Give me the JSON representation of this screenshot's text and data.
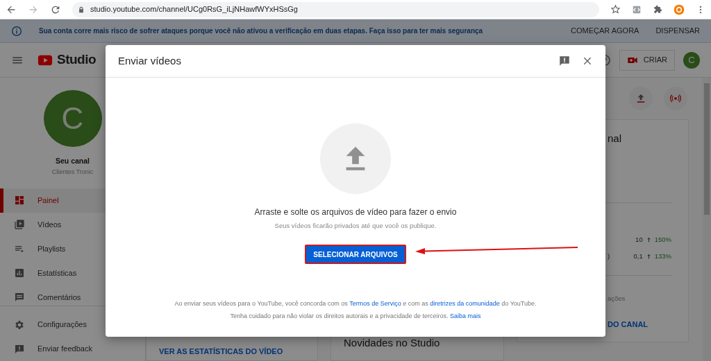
{
  "browser": {
    "url": "studio.youtube.com/channel/UCg0RsG_iLjNHawfWYxHSsGg"
  },
  "banner": {
    "message": "Sua conta corre mais risco de sofrer ataques porque você não ativou a verificação em duas etapas. Faça isso para ter mais segurança",
    "actions": [
      "COMEÇAR AGORA",
      "DISPENSAR"
    ]
  },
  "header": {
    "logo": "Studio",
    "create_button": "CRIAR",
    "avatar": "C"
  },
  "channel": {
    "avatar": "C",
    "title": "Seu canal",
    "name": "Clientes Tronic"
  },
  "nav": [
    {
      "label": "Painel",
      "kind": "dashboard",
      "selected": true
    },
    {
      "label": "Vídeos",
      "kind": "videos",
      "selected": false
    },
    {
      "label": "Playlists",
      "kind": "playlists",
      "selected": false
    },
    {
      "label": "Estatísticas",
      "kind": "analytics",
      "selected": false
    },
    {
      "label": "Comentários",
      "kind": "comments",
      "selected": false
    }
  ],
  "nav_footer": [
    {
      "label": "Configurações",
      "kind": "settings"
    },
    {
      "label": "Enviar feedback",
      "kind": "feedback"
    }
  ],
  "cards": {
    "video_stats_link": "VER AS ESTATÍSTICAS DO VÍDEO",
    "news_title": "Novidades no Studio",
    "channel": {
      "title": "nal",
      "rows": [
        {
          "value": "10",
          "change": "150%"
        },
        {
          "label": ")",
          "value": "0,1",
          "change": "133%"
        }
      ],
      "footer": "ações",
      "link": "DO CANAL"
    }
  },
  "dialog": {
    "title": "Enviar vídeos",
    "prompt": "Arraste e solte os arquivos de vídeo para fazer o envio",
    "note": "Seus vídeos ficarão privados até que você os publique.",
    "button": "SELECIONAR ARQUIVOS",
    "terms": [
      [
        {
          "text": "Ao enviar seus vídeos para o YouTube, você concorda com os "
        },
        {
          "text": "Termos de Serviço",
          "link": true
        },
        {
          "text": " e com as "
        },
        {
          "text": "diretrizes da comunidade",
          "link": true
        },
        {
          "text": " do YouTube."
        }
      ],
      [
        {
          "text": "Tenha cuidado para não violar os direitos autorais e a privacidade de terceiros. "
        },
        {
          "text": "Saiba mais",
          "link": true
        }
      ]
    ]
  }
}
